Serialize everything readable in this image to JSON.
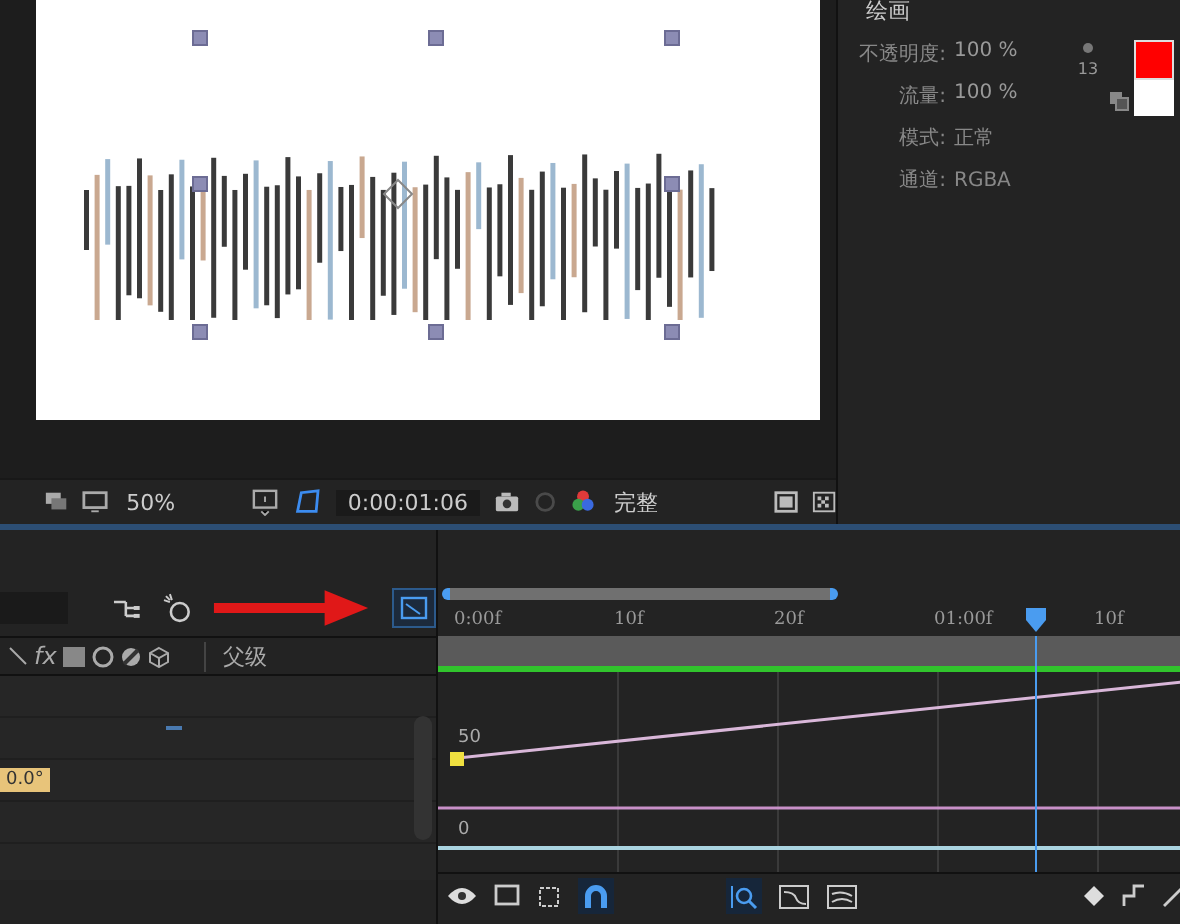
{
  "viewer": {
    "zoom": "50%",
    "timecode": "0:00:01:06",
    "resolution": "完整"
  },
  "paint_panel": {
    "title": "绘画",
    "opacity_label": "不透明度:",
    "opacity": "100 %",
    "flow_label": "流量:",
    "flow": "100 %",
    "brush_size": "13",
    "mode_label": "模式:",
    "mode": "正常",
    "channel_label": "通道:",
    "channel": "RGBA",
    "color_swatches": [
      {
        "color": "#ff0000"
      },
      {
        "color": "#ffffff"
      }
    ]
  },
  "timeline": {
    "graph_editor": {
      "selected": true
    },
    "fx_label": "fx",
    "parent_label": "父级",
    "value": "0.0°",
    "ruler": [
      "0:00f",
      "10f",
      "20f",
      "01:00f",
      "10f"
    ],
    "graph_labels": [
      "50",
      "0"
    ],
    "snap": {
      "on": true
    },
    "auto_zoom": {
      "on": true
    }
  }
}
